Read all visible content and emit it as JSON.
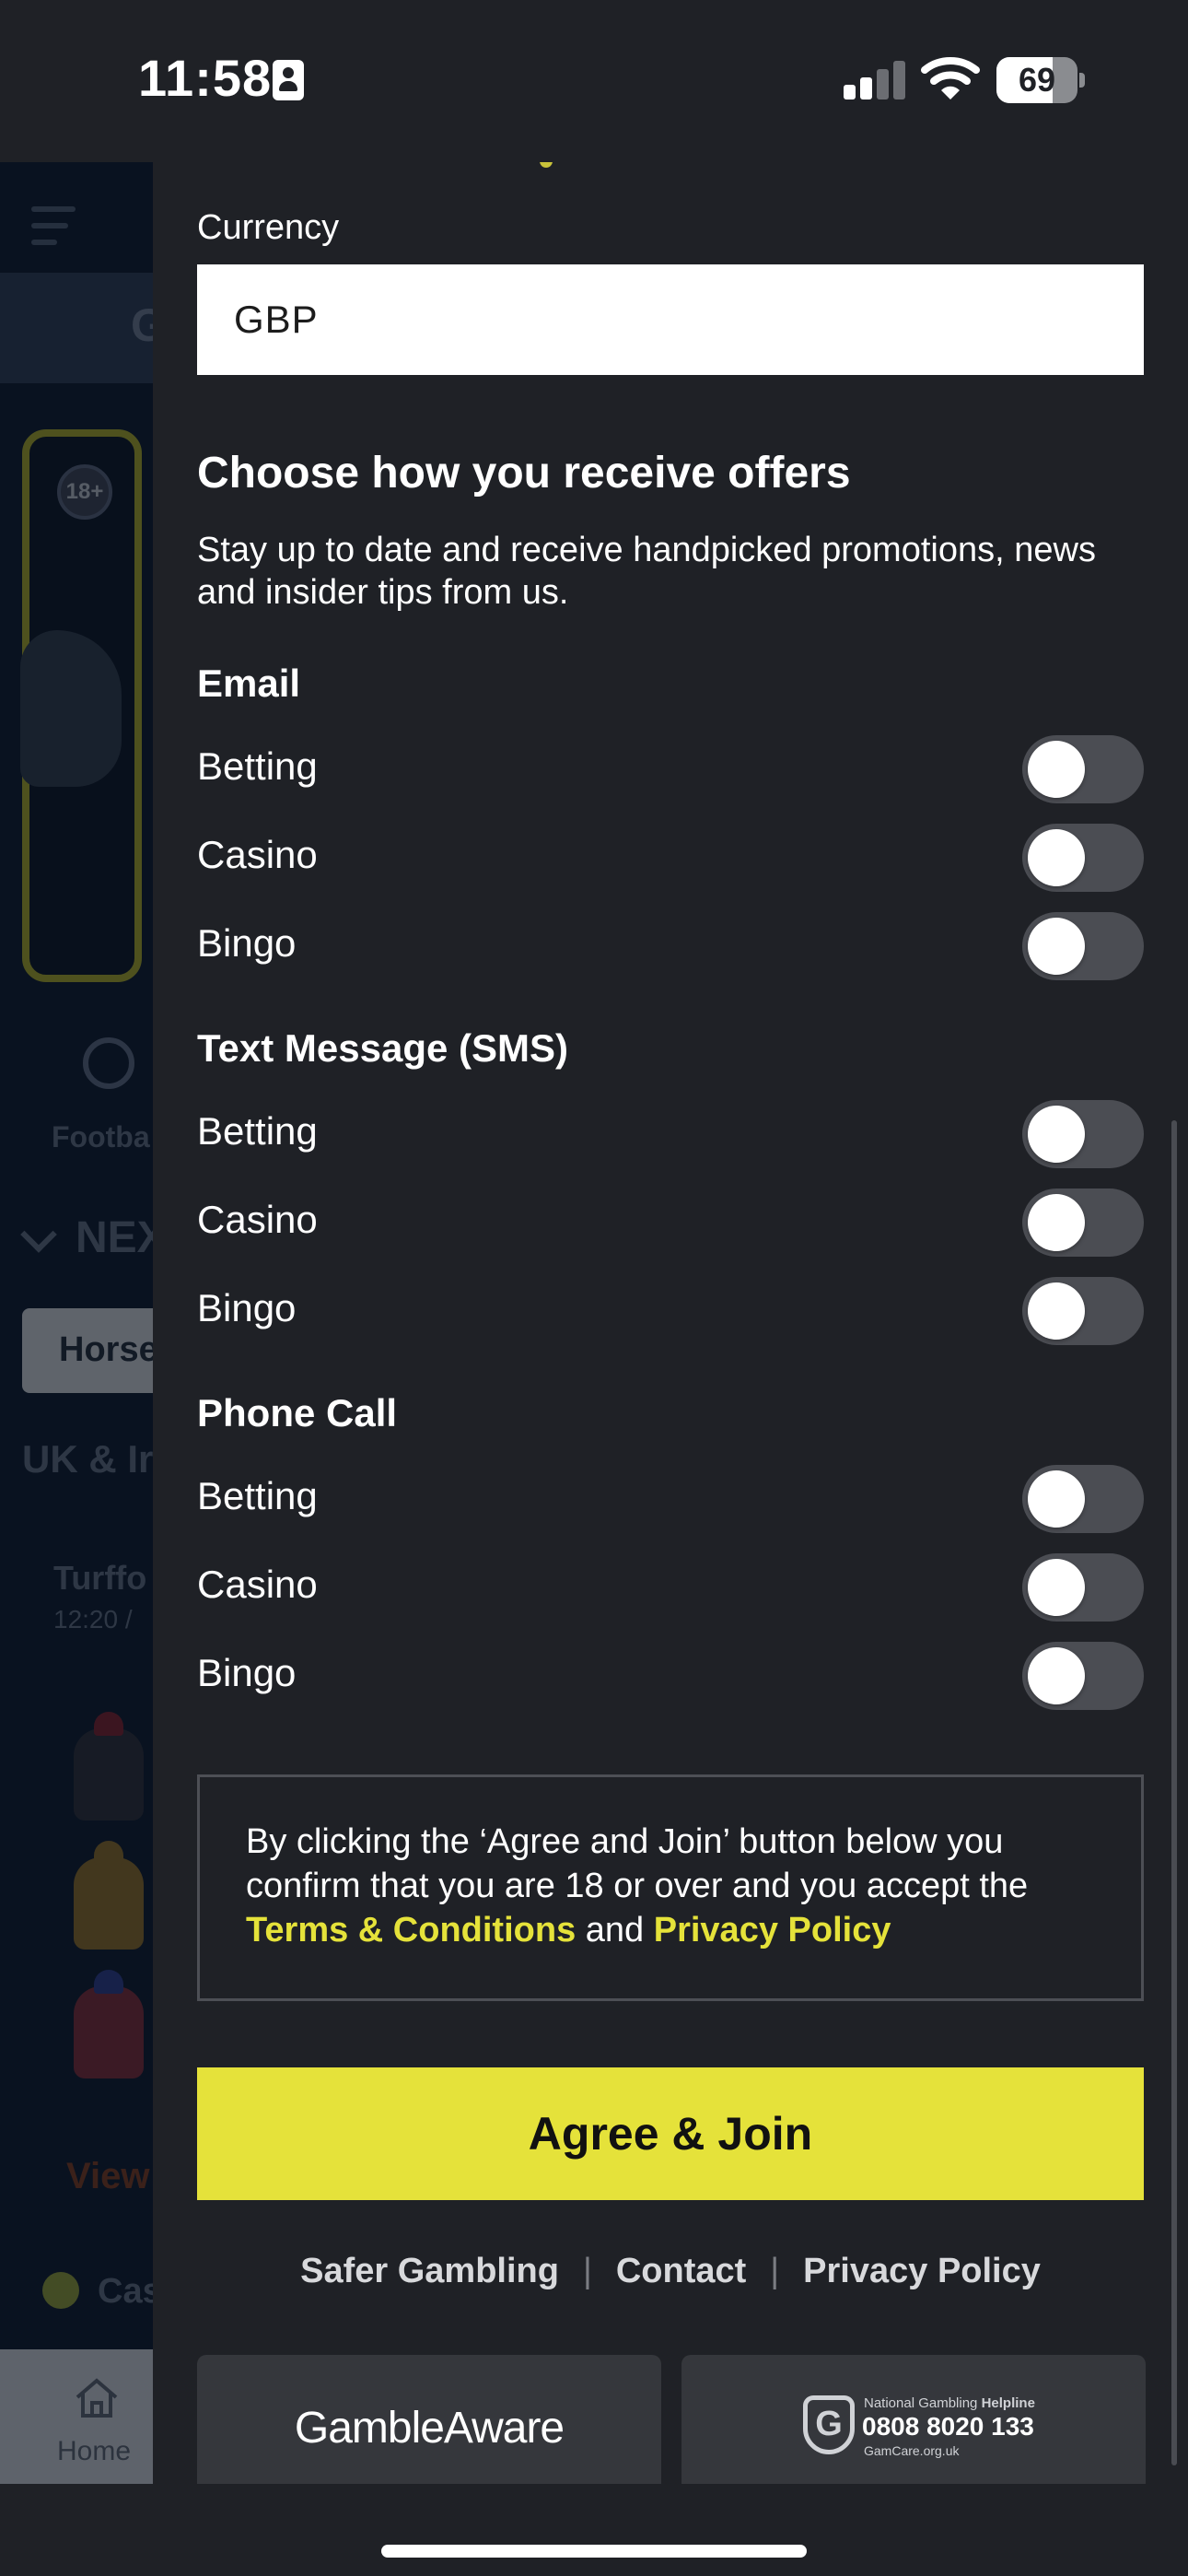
{
  "status_bar": {
    "time": "11:58",
    "battery_percent": "69",
    "battery_level": 0.69,
    "signal_bars_active": 2,
    "icons": [
      "contact-card-icon",
      "cellular-signal-icon",
      "wifi-icon",
      "battery-icon"
    ]
  },
  "background_app": {
    "tab_fragment": "G",
    "age_badge": "18+",
    "category_fragment": "Footba",
    "next_fragment": "NEX",
    "filter_fragment": "Horse",
    "region_fragment": "UK & Ir",
    "race_fragment": "Turffo",
    "race_time_fragment": "12:20 /",
    "view_fragment": "View",
    "casino_fragment": "Cas",
    "home_label": "Home"
  },
  "form": {
    "currency": {
      "label": "Currency",
      "value": "GBP"
    },
    "offers": {
      "heading": "Choose how you receive offers",
      "description": "Stay up to date and receive handpicked promotions, news and insider tips from us.",
      "groups": [
        {
          "title": "Email",
          "options": [
            {
              "label": "Betting",
              "on": false
            },
            {
              "label": "Casino",
              "on": false
            },
            {
              "label": "Bingo",
              "on": false
            }
          ]
        },
        {
          "title": "Text Message (SMS)",
          "options": [
            {
              "label": "Betting",
              "on": false
            },
            {
              "label": "Casino",
              "on": false
            },
            {
              "label": "Bingo",
              "on": false
            }
          ]
        },
        {
          "title": "Phone Call",
          "options": [
            {
              "label": "Betting",
              "on": false
            },
            {
              "label": "Casino",
              "on": false
            },
            {
              "label": "Bingo",
              "on": false
            }
          ]
        }
      ]
    },
    "consent": {
      "text_before": "By clicking the ‘Agree and Join’ button below you confirm that you are 18 or over and you accept the",
      "terms_link": "Terms & Conditions",
      "and": "and",
      "privacy_link": "Privacy Policy"
    },
    "submit_label": "Agree & Join"
  },
  "footer": {
    "links": [
      "Safer Gambling",
      "Contact",
      "Privacy Policy"
    ],
    "separator": "|",
    "gambleaware": "GambleAware",
    "gamcare": {
      "line1_prefix": "National Gambling",
      "line1_bold": "Helpline",
      "phone": "0808 8020 133",
      "site": "GamCare.org.uk"
    }
  },
  "colors": {
    "background": "#1f2126",
    "accent_yellow": "#e5e23a",
    "toggle_off": "#4b4d53",
    "input_bg": "#ffffff"
  }
}
